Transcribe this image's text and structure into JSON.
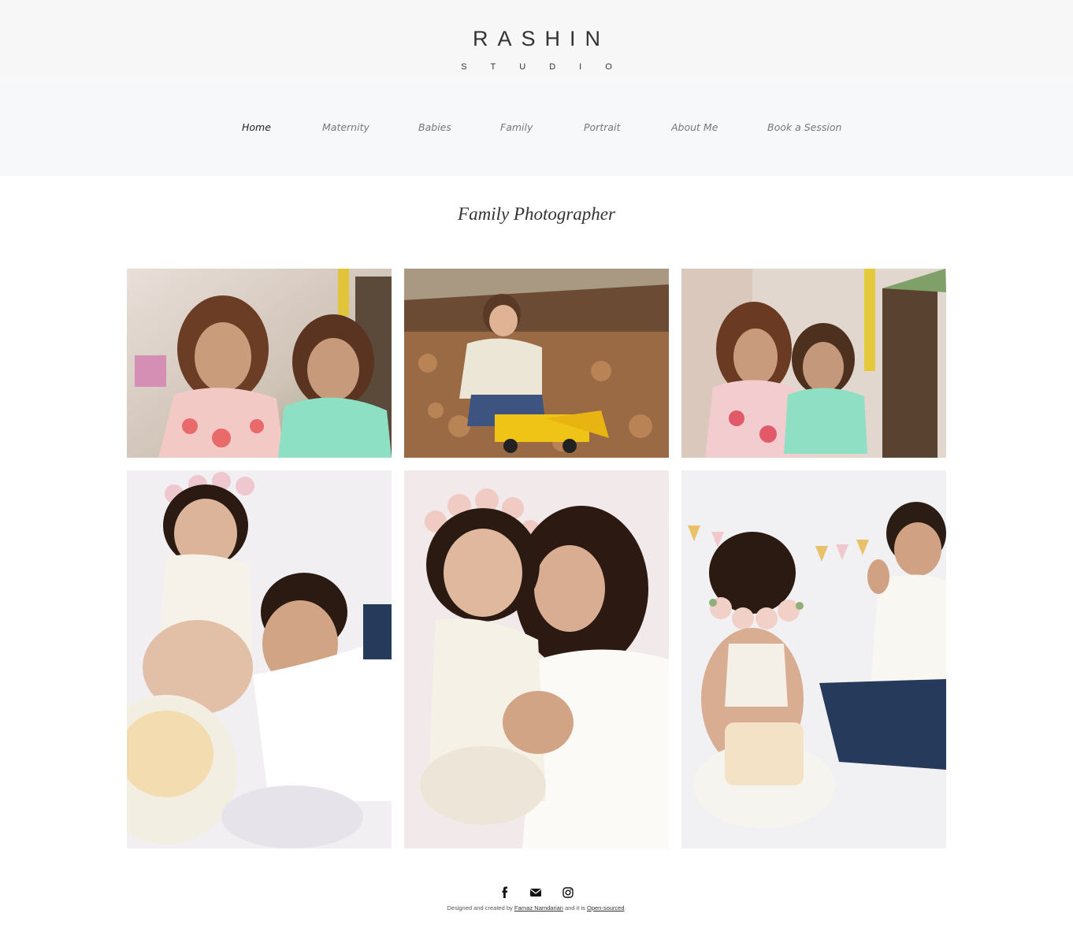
{
  "brand": {
    "name": "RASHIN",
    "subtitle": "STUDIO"
  },
  "nav": {
    "items": [
      {
        "label": "Home",
        "active": true
      },
      {
        "label": "Maternity",
        "active": false
      },
      {
        "label": "Babies",
        "active": false
      },
      {
        "label": "Family",
        "active": false
      },
      {
        "label": "Portrait",
        "active": false
      },
      {
        "label": "About Me",
        "active": false
      },
      {
        "label": "Book a Session",
        "active": false
      }
    ]
  },
  "page": {
    "title": "Family Photographer"
  },
  "gallery": {
    "photos": [
      {
        "icon": "photo-two-children-smiling"
      },
      {
        "icon": "photo-toddler-autumn-leaves-toy-truck"
      },
      {
        "icon": "photo-two-children-porch"
      },
      {
        "icon": "photo-cake-smash-boy-girl"
      },
      {
        "icon": "photo-mother-holding-baby"
      },
      {
        "icon": "photo-cake-smash-siblings"
      }
    ]
  },
  "footer": {
    "social_icons": [
      "facebook-icon",
      "email-icon",
      "instagram-icon"
    ],
    "text_before": "Designed and created by ",
    "author_link": "Farnaz Namdarian",
    "text_middle": " and it is ",
    "source_link": "Open-sourced",
    "text_after": "."
  }
}
